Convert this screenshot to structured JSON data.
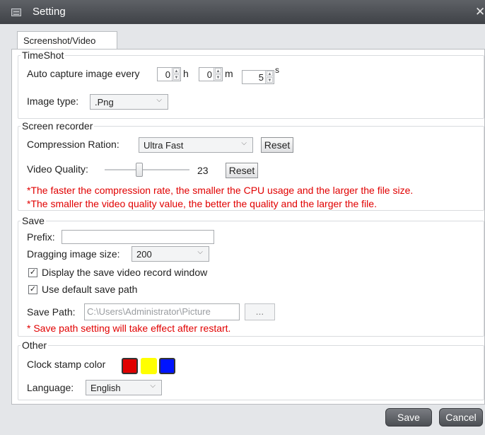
{
  "window": {
    "title": "Setting",
    "close_glyph": "✕"
  },
  "tabs": [
    {
      "label": "Screenshot/Video"
    }
  ],
  "timeshot": {
    "legend": "TimeShot",
    "auto_capture_label": "Auto capture image every",
    "hours_value": "0",
    "hours_unit": "h",
    "minutes_value": "0",
    "minutes_unit": "m",
    "seconds_value": "5",
    "seconds_unit": "s",
    "image_type_label": "Image type:",
    "image_type_value": ".Png"
  },
  "recorder": {
    "legend": "Screen recorder",
    "compression_label": "Compression Ration:",
    "compression_value": "Ultra Fast",
    "compression_reset": "Reset",
    "quality_label": "Video Quality:",
    "quality_value": "23",
    "quality_level": 0.4,
    "quality_reset": "Reset",
    "note1": "*The faster the compression rate, the smaller the CPU usage and the larger the file size.",
    "note2": "*The smaller the video quality value, the better the quality and the larger the file."
  },
  "save": {
    "legend": "Save",
    "prefix_label": "Prefix:",
    "prefix_value": "",
    "dragging_label": "Dragging image size:",
    "dragging_value": "200",
    "display_window_label": "Display the save video  record window",
    "display_window_checked": true,
    "default_path_label": "Use default save path",
    "default_path_checked": true,
    "save_path_label": "Save Path:",
    "save_path_value": "C:\\Users\\Administrator\\Picture",
    "browse_label": "...",
    "note": "* Save path setting will take effect after restart."
  },
  "other": {
    "legend": "Other",
    "clock_color_label": "Clock stamp color",
    "colors": [
      "#e00000",
      "#ffff00",
      "#0014ff"
    ],
    "language_label": "Language:",
    "language_value": "English"
  },
  "footer": {
    "save_label": "Save",
    "cancel_label": "Cancel"
  }
}
